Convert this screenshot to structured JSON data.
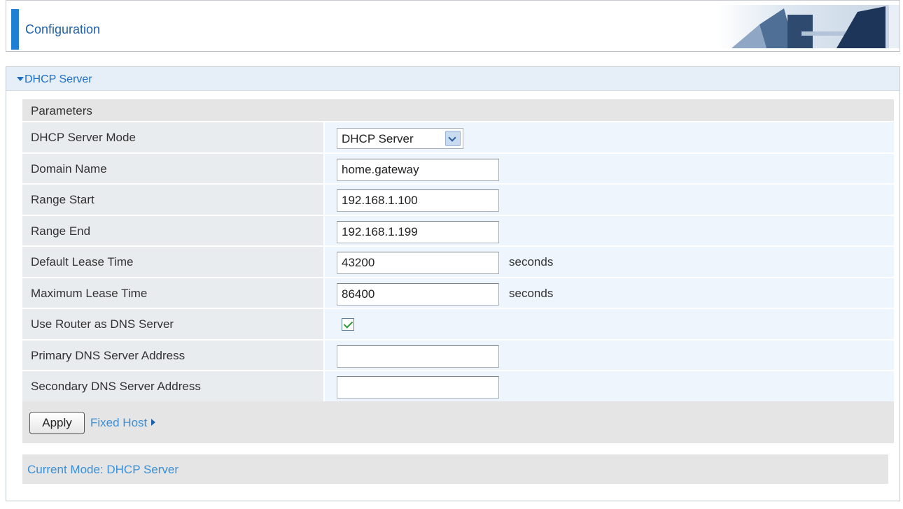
{
  "banner": {
    "title": "Configuration"
  },
  "panel": {
    "title": "DHCP Server"
  },
  "params_header": "Parameters",
  "fields": [
    {
      "label": "DHCP Server Mode",
      "type": "select",
      "value": "DHCP Server"
    },
    {
      "label": "Domain Name",
      "type": "text",
      "value": "home.gateway"
    },
    {
      "label": "Range Start",
      "type": "text",
      "value": "192.168.1.100"
    },
    {
      "label": "Range End",
      "type": "text",
      "value": "192.168.1.199"
    },
    {
      "label": "Default Lease Time",
      "type": "text",
      "value": "43200",
      "unit": "seconds"
    },
    {
      "label": "Maximum Lease Time",
      "type": "text",
      "value": "86400",
      "unit": "seconds"
    },
    {
      "label": "Use Router as DNS Server",
      "type": "checkbox",
      "checked": true
    },
    {
      "label": "Primary DNS Server Address",
      "type": "text",
      "value": ""
    },
    {
      "label": "Secondary DNS Server Address",
      "type": "text",
      "value": ""
    }
  ],
  "actions": {
    "apply_label": "Apply",
    "fixed_host_label": "Fixed Host"
  },
  "status": {
    "text": "Current Mode: DHCP Server"
  },
  "colors": {
    "accent": "#1f7fd4",
    "link": "#3a8fd6",
    "title_blue": "#1d6fc4"
  },
  "icons": {
    "section_toggle": "triangle-down-icon",
    "fixed_host_arrow": "triangle-right-icon",
    "select_arrow": "chevron-down-icon",
    "checkbox": "checkmark-icon"
  }
}
